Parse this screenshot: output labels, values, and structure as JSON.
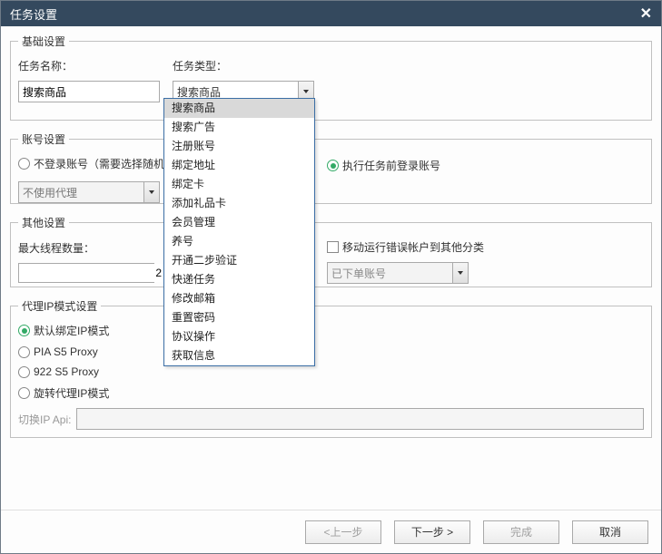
{
  "window": {
    "title": "任务设置"
  },
  "basic": {
    "legend": "基础设置",
    "task_name_label": "任务名称：",
    "task_name_value": "搜索商品",
    "task_type_label": "任务类型：",
    "task_type_selected": "搜索商品",
    "task_type_options": [
      "搜索商品",
      "搜索广告",
      "注册账号",
      "绑定地址",
      "绑定卡",
      "添加礼品卡",
      "会员管理",
      "养号",
      "开通二步验证",
      "快递任务",
      "修改邮箱",
      "重置密码",
      "协议操作",
      "获取信息"
    ]
  },
  "account": {
    "legend": "账号设置",
    "no_login_label": "不登录账号（需要选择随机",
    "login_before_task_label": "执行任务前登录账号",
    "proxy_selected": "不使用代理"
  },
  "other": {
    "legend": "其他设置",
    "max_threads_label": "最大线程数量：",
    "max_threads_value": "2",
    "move_error_label": "移动运行错误帐户到其他分类",
    "ordered_account_selected": "已下单账号"
  },
  "proxy_mode": {
    "legend": "代理IP模式设置",
    "default_bind_label": "默认绑定IP模式",
    "pia_label": "PIA S5 Proxy",
    "s922_label": "922 S5 Proxy",
    "rotate_label": "旋转代理IP模式",
    "switch_api_label": "切换IP Api:"
  },
  "footer": {
    "prev": "<上一步",
    "next": "下一步 >",
    "finish": "完成",
    "cancel": "取消"
  }
}
